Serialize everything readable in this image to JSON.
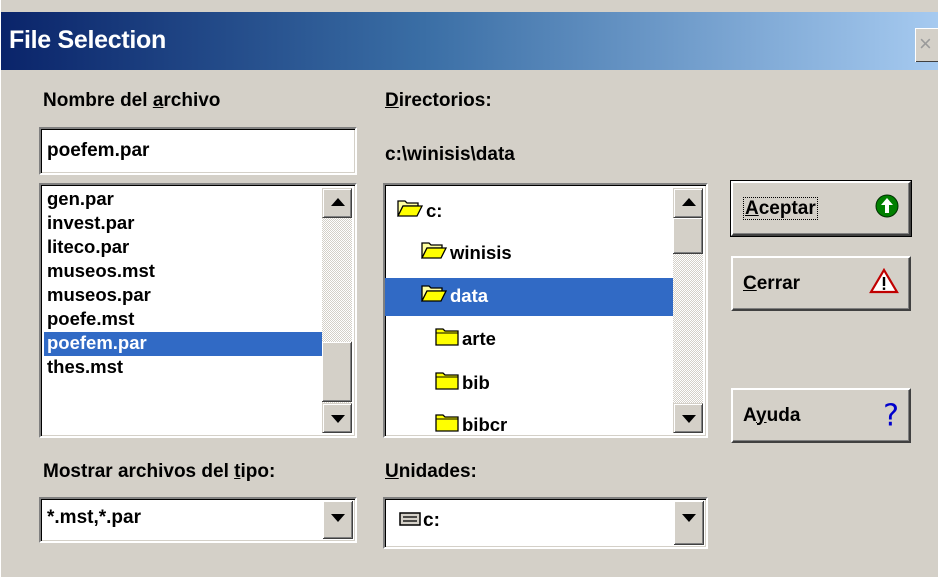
{
  "window": {
    "title": "File Selection",
    "close_glyph": "×"
  },
  "file_name": {
    "label_before": "Nombre del ",
    "label_accel": "a",
    "label_after": "rchivo",
    "value": "poefem.par"
  },
  "files": {
    "items": [
      "gen.par",
      "invest.par",
      "liteco.par",
      "museos.mst",
      "museos.par",
      "poefe.mst",
      "poefem.par",
      "thes.mst"
    ],
    "selected": "poefem.par"
  },
  "directories": {
    "label_accel": "D",
    "label_after": "irectorios:",
    "current_path": "c:\\winisis\\data",
    "tree": [
      {
        "name": "c:",
        "state": "open"
      },
      {
        "name": "winisis",
        "state": "open"
      },
      {
        "name": "data",
        "state": "open",
        "selected": true
      },
      {
        "name": "arte",
        "state": "closed"
      },
      {
        "name": "bib",
        "state": "closed"
      },
      {
        "name": "bibcr",
        "state": "closed"
      }
    ]
  },
  "buttons": {
    "accept": {
      "accel": "A",
      "rest": "ceptar",
      "icon": "green-up-arrow-icon"
    },
    "close": {
      "accel": "C",
      "rest": "errar",
      "icon": "warning-triangle-icon"
    },
    "help": {
      "pre": "A",
      "accel": "y",
      "rest": "uda",
      "icon": "question-mark-icon",
      "glyph": "?"
    }
  },
  "file_type": {
    "label_before": "Mostrar archivos del ",
    "label_accel": "t",
    "label_after": "ipo:",
    "value": "*.mst,*.par"
  },
  "drives": {
    "label_accel": "U",
    "label_after": "nidades:",
    "value": "c:",
    "icon": "drive-icon"
  },
  "colors": {
    "selection": "#316ac5",
    "title_start": "#0a246a",
    "title_end": "#a6caf0",
    "face": "#d4d0c8"
  }
}
